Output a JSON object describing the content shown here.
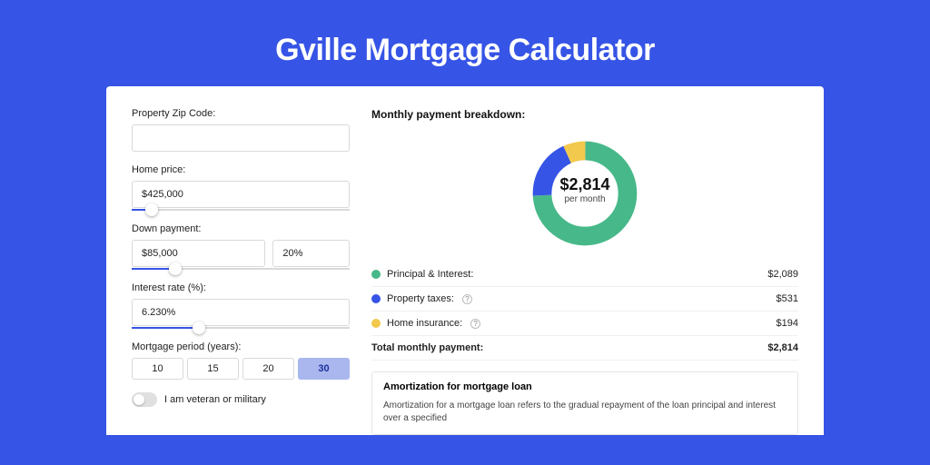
{
  "title": "Gville Mortgage Calculator",
  "form": {
    "zip_label": "Property Zip Code:",
    "zip_value": "",
    "home_price_label": "Home price:",
    "home_price_value": "$425,000",
    "down_payment_label": "Down payment:",
    "down_payment_value": "$85,000",
    "down_payment_pct": "20%",
    "interest_label": "Interest rate (%):",
    "interest_value": "6.230%",
    "period_label": "Mortgage period (years):",
    "periods": [
      "10",
      "15",
      "20",
      "30"
    ],
    "period_active_index": 3,
    "veteran_label": "I am veteran or military"
  },
  "breakdown": {
    "title": "Monthly payment breakdown:",
    "center_amount": "$2,814",
    "center_sub": "per month",
    "items": [
      {
        "label": "Principal & Interest:",
        "amount": "$2,089",
        "color": "#47b889",
        "info": false
      },
      {
        "label": "Property taxes:",
        "amount": "$531",
        "color": "#3654e6",
        "info": true
      },
      {
        "label": "Home insurance:",
        "amount": "$194",
        "color": "#f2c94c",
        "info": true
      }
    ],
    "total_label": "Total monthly payment:",
    "total_amount": "$2,814"
  },
  "amortization": {
    "title": "Amortization for mortgage loan",
    "text": "Amortization for a mortgage loan refers to the gradual repayment of the loan principal and interest over a specified"
  },
  "chart_data": {
    "type": "pie",
    "title": "Monthly payment breakdown",
    "series": [
      {
        "name": "Principal & Interest",
        "value": 2089,
        "color": "#47b889"
      },
      {
        "name": "Property taxes",
        "value": 531,
        "color": "#3654e6"
      },
      {
        "name": "Home insurance",
        "value": 194,
        "color": "#f2c94c"
      }
    ],
    "total": 2814,
    "center_label": "$2,814 per month"
  }
}
